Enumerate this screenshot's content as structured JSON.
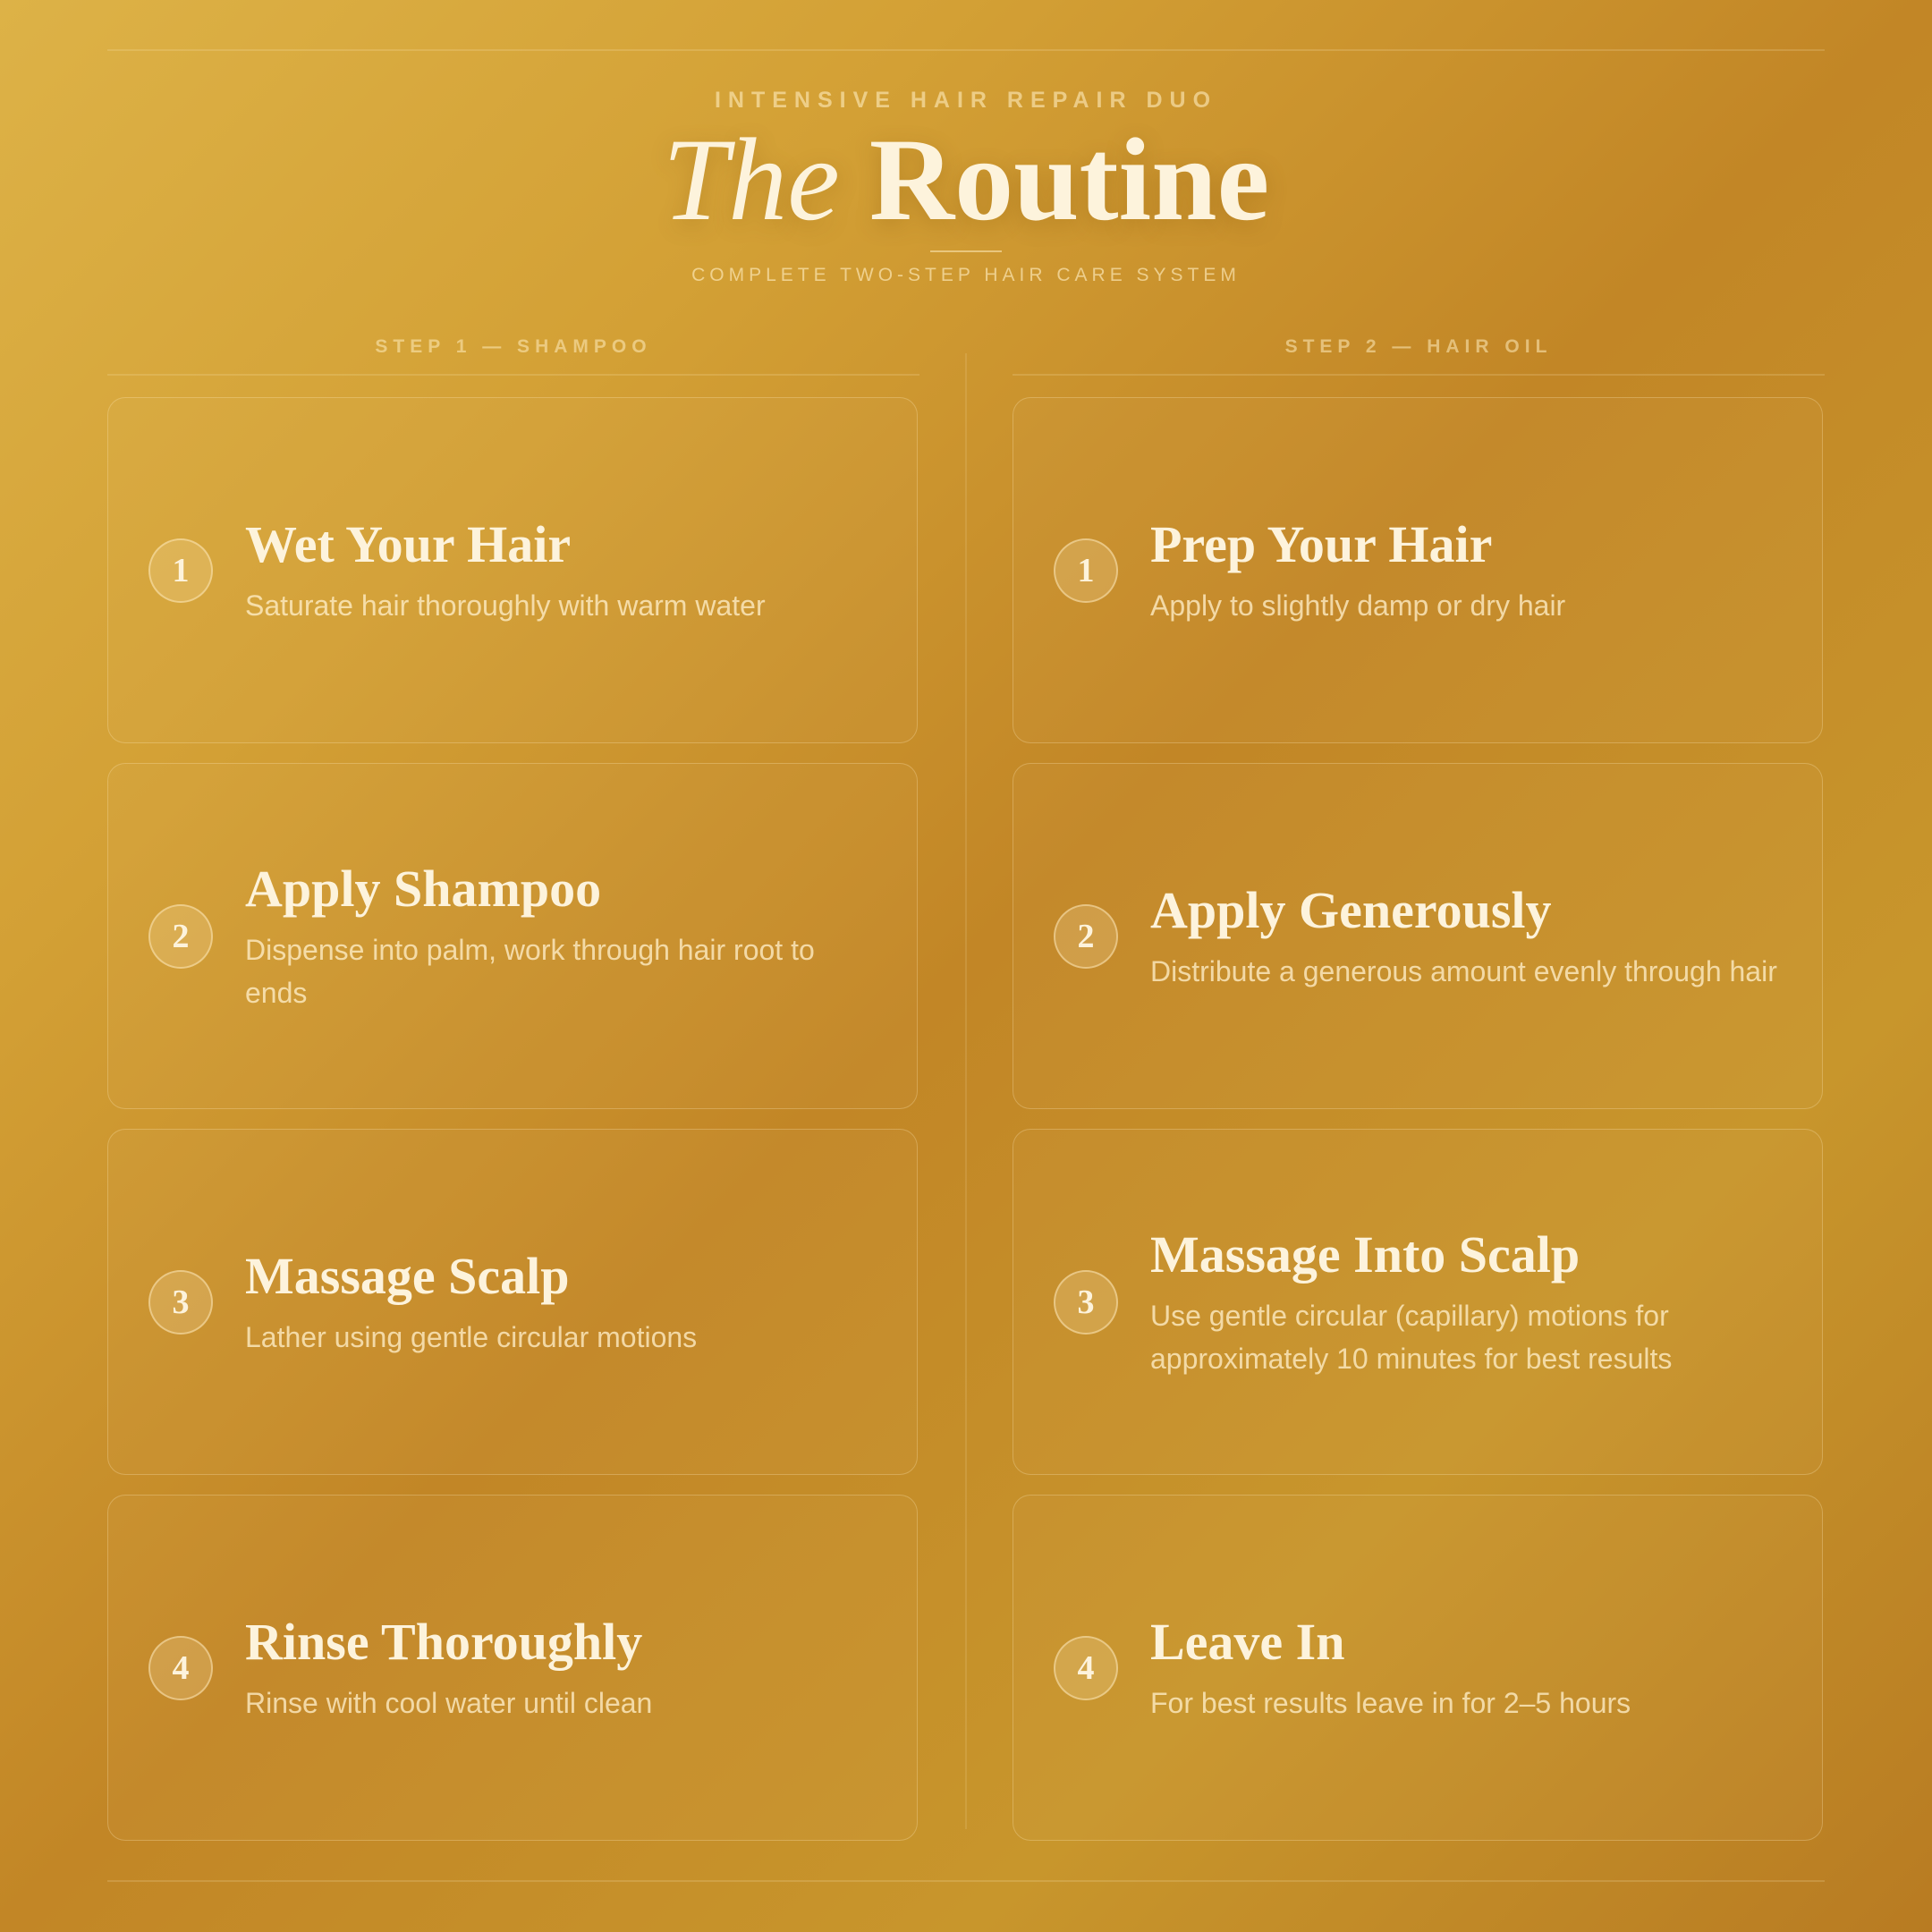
{
  "header": {
    "eyebrow": "INTENSIVE HAIR REPAIR DUO",
    "title_italic": "The",
    "title_bold": "Routine",
    "tagline": "COMPLETE TWO-STEP HAIR CARE SYSTEM"
  },
  "columns": [
    {
      "heading": "STEP 1 — SHAMPOO",
      "steps": [
        {
          "number": "1",
          "title": "Wet Your Hair",
          "description": "Saturate hair thoroughly with warm water"
        },
        {
          "number": "2",
          "title": "Apply Shampoo",
          "description": "Dispense into palm, work through hair root to ends"
        },
        {
          "number": "3",
          "title": "Massage Scalp",
          "description": "Lather using gentle circular motions"
        },
        {
          "number": "4",
          "title": "Rinse Thoroughly",
          "description": "Rinse with cool water until clean"
        }
      ]
    },
    {
      "heading": "STEP 2 — HAIR OIL",
      "steps": [
        {
          "number": "1",
          "title": "Prep Your Hair",
          "description": "Apply to slightly damp or dry hair"
        },
        {
          "number": "2",
          "title": "Apply Generously",
          "description": "Distribute a generous amount evenly through hair"
        },
        {
          "number": "3",
          "title": "Massage Into Scalp",
          "description": "Use gentle circular (capillary) motions for approximately 10 minutes for best results"
        },
        {
          "number": "4",
          "title": "Leave In",
          "description": "For best results leave in for 2–5 hours"
        }
      ]
    }
  ],
  "colors": {
    "background_light": "#ddb247",
    "background_dark": "#b87b22",
    "text_cream": "#fdf3dc"
  }
}
